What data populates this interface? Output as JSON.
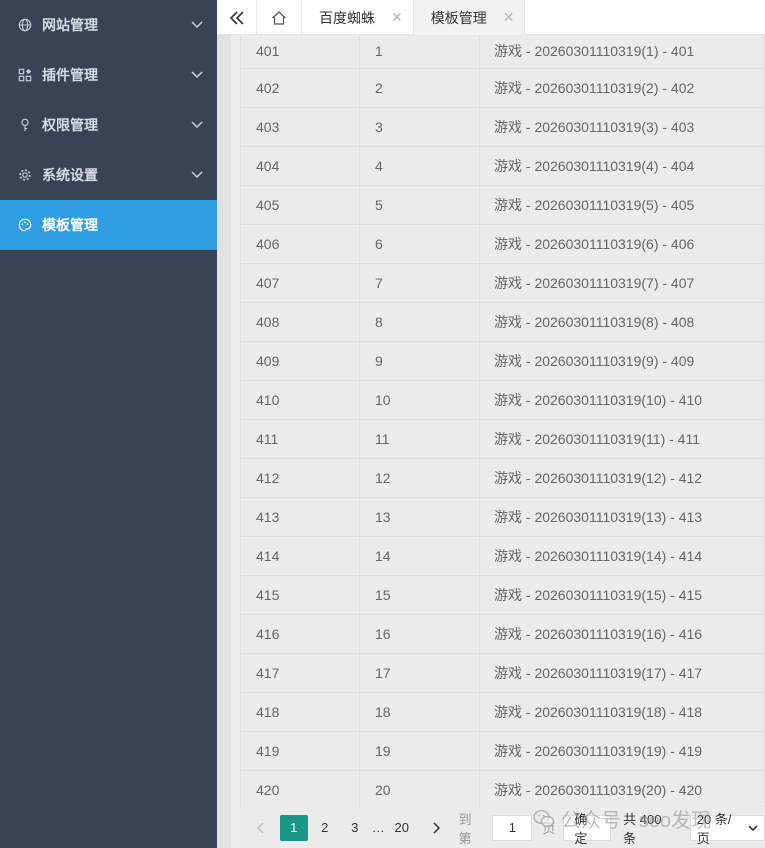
{
  "sidebar": {
    "items": [
      {
        "label": "网站管理",
        "icon": "globe-icon",
        "has_children": true
      },
      {
        "label": "插件管理",
        "icon": "plugin-grid-icon",
        "has_children": true
      },
      {
        "label": "权限管理",
        "icon": "key-icon",
        "has_children": true
      },
      {
        "label": "系统设置",
        "icon": "gear-icon",
        "has_children": true
      },
      {
        "label": "模板管理",
        "icon": "palette-icon",
        "has_children": false,
        "active": true
      }
    ]
  },
  "tabs": [
    {
      "label": "百度蜘蛛",
      "active": false
    },
    {
      "label": "模板管理",
      "active": true
    }
  ],
  "table": {
    "rows": [
      {
        "id": "401",
        "no": "1",
        "title": "游戏 - 20260301110319(1) - 401"
      },
      {
        "id": "402",
        "no": "2",
        "title": "游戏 - 20260301110319(2) - 402"
      },
      {
        "id": "403",
        "no": "3",
        "title": "游戏 - 20260301110319(3) - 403"
      },
      {
        "id": "404",
        "no": "4",
        "title": "游戏 - 20260301110319(4) - 404"
      },
      {
        "id": "405",
        "no": "5",
        "title": "游戏 - 20260301110319(5) - 405"
      },
      {
        "id": "406",
        "no": "6",
        "title": "游戏 - 20260301110319(6) - 406"
      },
      {
        "id": "407",
        "no": "7",
        "title": "游戏 - 20260301110319(7) - 407"
      },
      {
        "id": "408",
        "no": "8",
        "title": "游戏 - 20260301110319(8) - 408"
      },
      {
        "id": "409",
        "no": "9",
        "title": "游戏 - 20260301110319(9) - 409"
      },
      {
        "id": "410",
        "no": "10",
        "title": "游戏 - 20260301110319(10) - 410"
      },
      {
        "id": "411",
        "no": "11",
        "title": "游戏 - 20260301110319(11) - 411"
      },
      {
        "id": "412",
        "no": "12",
        "title": "游戏 - 20260301110319(12) - 412"
      },
      {
        "id": "413",
        "no": "13",
        "title": "游戏 - 20260301110319(13) - 413"
      },
      {
        "id": "414",
        "no": "14",
        "title": "游戏 - 20260301110319(14) - 414"
      },
      {
        "id": "415",
        "no": "15",
        "title": "游戏 - 20260301110319(15) - 415"
      },
      {
        "id": "416",
        "no": "16",
        "title": "游戏 - 20260301110319(16) - 416"
      },
      {
        "id": "417",
        "no": "17",
        "title": "游戏 - 20260301110319(17) - 417"
      },
      {
        "id": "418",
        "no": "18",
        "title": "游戏 - 20260301110319(18) - 418"
      },
      {
        "id": "419",
        "no": "19",
        "title": "游戏 - 20260301110319(19) - 419"
      },
      {
        "id": "420",
        "no": "20",
        "title": "游戏 - 20260301110319(20) - 420"
      }
    ]
  },
  "pager": {
    "prev": "‹",
    "pages": [
      "1",
      "2",
      "3"
    ],
    "current_page": "1",
    "ellipsis": "…",
    "last_page": "20",
    "next": "›",
    "goto_label": "到第",
    "goto_value": "1",
    "page_unit": "页",
    "confirm_label": "确定",
    "total_label": "共 400 条",
    "page_size_label": "20 条/页"
  },
  "watermark": {
    "text": "公众号 · seo发现",
    "icon": "wechat-icon"
  },
  "colors": {
    "sidebar_bg": "#394355",
    "active_item": "#2f9ee3",
    "pager_active": "#1a9687"
  }
}
